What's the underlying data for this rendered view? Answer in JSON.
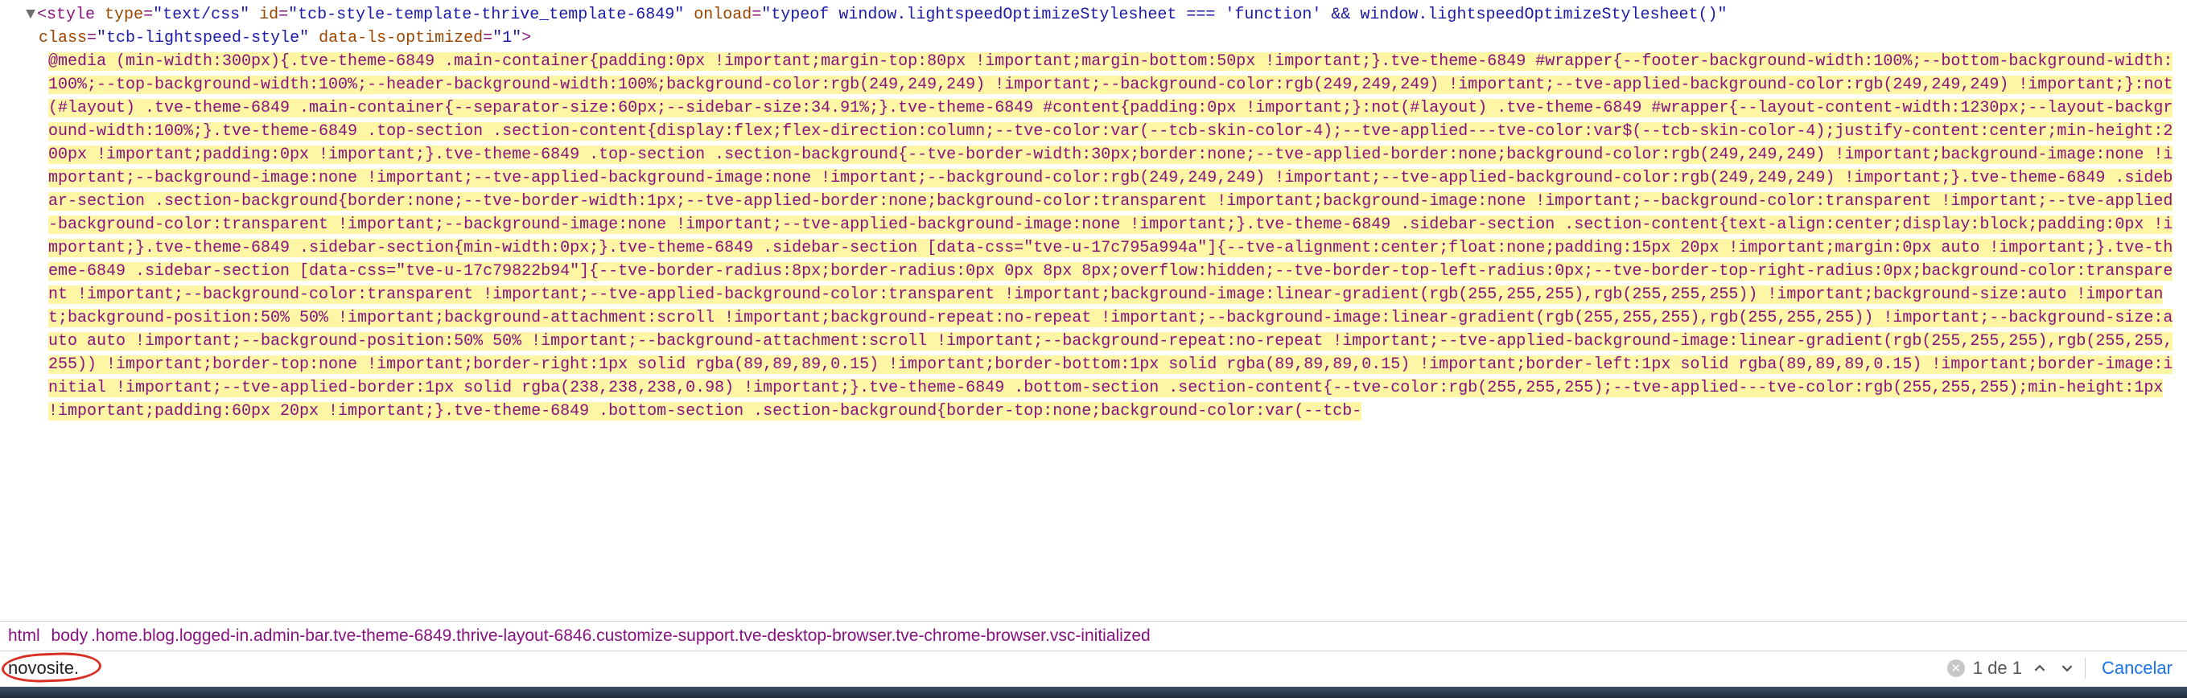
{
  "element": {
    "tag": "style",
    "attrs": {
      "type_name": "type",
      "type_value": "\"text/css\"",
      "id_name": "id",
      "id_value": "\"tcb-style-template-thrive_template-6849\"",
      "onload_name": "onload",
      "onload_value": "\"typeof window.lightspeedOptimizeStylesheet === 'function' && window.lightspeedOptimizeStylesheet()\"",
      "class_name": "class",
      "class_value": "\"tcb-lightspeed-style\"",
      "datals_name": "data-ls-optimized",
      "datals_value": "\"1\""
    },
    "css_text": "@media (min-width:300px){.tve-theme-6849 .main-container{padding:0px !important;margin-top:80px !important;margin-bottom:50px !important;}.tve-theme-6849 #wrapper{--footer-background-width:100%;--bottom-background-width:100%;--top-background-width:100%;--header-background-width:100%;background-color:rgb(249,249,249) !important;--background-color:rgb(249,249,249) !important;--tve-applied-background-color:rgb(249,249,249) !important;}:not(#layout) .tve-theme-6849 .main-container{--separator-size:60px;--sidebar-size:34.91%;}.tve-theme-6849 #content{padding:0px !important;}:not(#layout) .tve-theme-6849 #wrapper{--layout-content-width:1230px;--layout-background-width:100%;}.tve-theme-6849 .top-section .section-content{display:flex;flex-direction:column;--tve-color:var(--tcb-skin-color-4);--tve-applied---tve-color:var$(--tcb-skin-color-4);justify-content:center;min-height:200px !important;padding:0px !important;}.tve-theme-6849 .top-section .section-background{--tve-border-width:30px;border:none;--tve-applied-border:none;background-color:rgb(249,249,249) !important;background-image:none !important;--background-image:none !important;--tve-applied-background-image:none !important;--background-color:rgb(249,249,249) !important;--tve-applied-background-color:rgb(249,249,249) !important;}.tve-theme-6849 .sidebar-section .section-background{border:none;--tve-border-width:1px;--tve-applied-border:none;background-color:transparent !important;background-image:none !important;--background-color:transparent !important;--tve-applied-background-color:transparent !important;--background-image:none !important;--tve-applied-background-image:none !important;}.tve-theme-6849 .sidebar-section .section-content{text-align:center;display:block;padding:0px !important;}.tve-theme-6849 .sidebar-section{min-width:0px;}.tve-theme-6849 .sidebar-section [data-css=\"tve-u-17c795a994a\"]{--tve-alignment:center;float:none;padding:15px 20px !important;margin:0px auto !important;}.tve-theme-6849 .sidebar-section [data-css=\"tve-u-17c79822b94\"]{--tve-border-radius:8px;border-radius:0px 0px 8px 8px;overflow:hidden;--tve-border-top-left-radius:0px;--tve-border-top-right-radius:0px;background-color:transparent !important;--background-color:transparent !important;--tve-applied-background-color:transparent !important;background-image:linear-gradient(rgb(255,255,255),rgb(255,255,255)) !important;background-size:auto !important;background-position:50% 50% !important;background-attachment:scroll !important;background-repeat:no-repeat !important;--background-image:linear-gradient(rgb(255,255,255),rgb(255,255,255)) !important;--background-size:auto auto !important;--background-position:50% 50% !important;--background-attachment:scroll !important;--background-repeat:no-repeat !important;--tve-applied-background-image:linear-gradient(rgb(255,255,255),rgb(255,255,255)) !important;border-top:none !important;border-right:1px solid rgba(89,89,89,0.15) !important;border-bottom:1px solid rgba(89,89,89,0.15) !important;border-left:1px solid rgba(89,89,89,0.15) !important;border-image:initial !important;--tve-applied-border:1px solid rgba(238,238,238,0.98) !important;}.tve-theme-6849 .bottom-section .section-content{--tve-color:rgb(255,255,255);--tve-applied---tve-color:rgb(255,255,255);min-height:1px !important;padding:60px 20px !important;}.tve-theme-6849 .bottom-section .section-background{border-top:none;background-color:var(--tcb-"
  },
  "breadcrumb": {
    "html": "html",
    "body_tag": "body",
    "body_classes": ".home.blog.logged-in.admin-bar.tve-theme-6849.thrive-layout-6846.customize-support.tve-desktop-browser.tve-chrome-browser.vsc-initialized"
  },
  "search": {
    "query": "novosite.",
    "match_count": "1 de 1",
    "cancel_label": "Cancelar"
  }
}
